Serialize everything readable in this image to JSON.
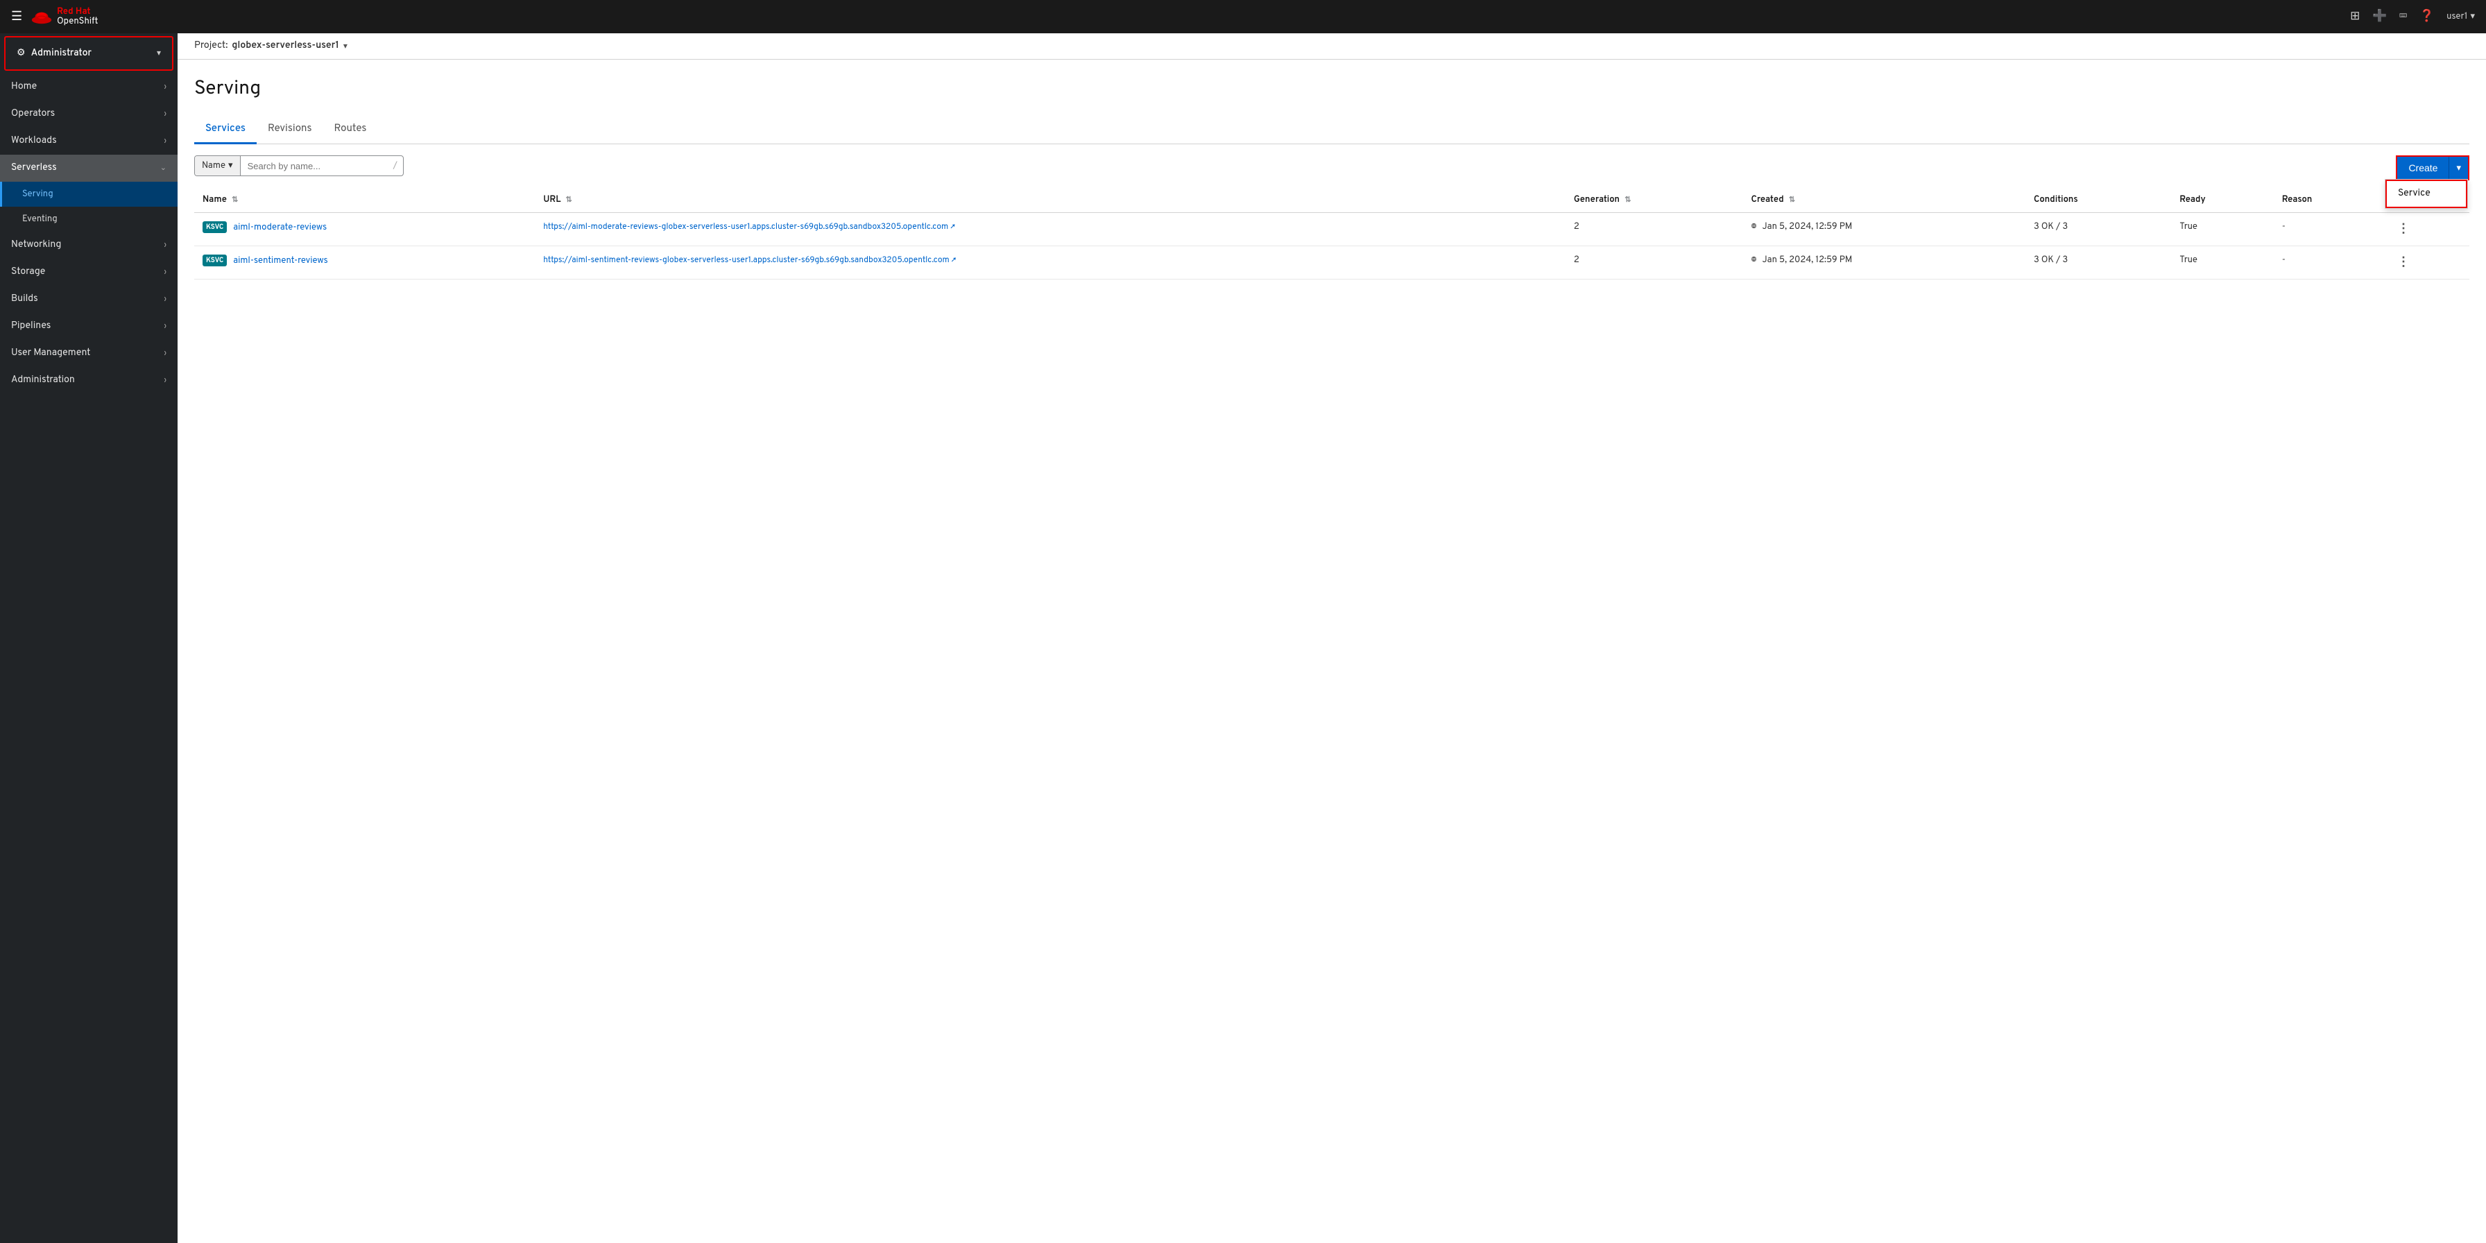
{
  "topnav": {
    "brand_red": "Red Hat",
    "brand_sub": "OpenShift",
    "user_label": "user1"
  },
  "sidebar": {
    "role_label": "Administrator",
    "nav_items": [
      {
        "id": "home",
        "label": "Home",
        "has_children": true
      },
      {
        "id": "operators",
        "label": "Operators",
        "has_children": true
      },
      {
        "id": "workloads",
        "label": "Workloads",
        "has_children": true
      },
      {
        "id": "serverless",
        "label": "Serverless",
        "has_children": true,
        "expanded": true
      },
      {
        "id": "networking",
        "label": "Networking",
        "has_children": true
      },
      {
        "id": "storage",
        "label": "Storage",
        "has_children": true
      },
      {
        "id": "builds",
        "label": "Builds",
        "has_children": true
      },
      {
        "id": "pipelines",
        "label": "Pipelines",
        "has_children": true
      },
      {
        "id": "user_management",
        "label": "User Management",
        "has_children": true
      },
      {
        "id": "administration",
        "label": "Administration",
        "has_children": true
      }
    ],
    "serverless_sub_items": [
      {
        "id": "serving",
        "label": "Serving",
        "active": true
      },
      {
        "id": "eventing",
        "label": "Eventing",
        "active": false
      }
    ]
  },
  "project_bar": {
    "label": "Project:",
    "project_name": "globex-serverless-user1"
  },
  "page": {
    "title": "Serving",
    "tabs": [
      {
        "id": "services",
        "label": "Services",
        "active": true
      },
      {
        "id": "revisions",
        "label": "Revisions",
        "active": false
      },
      {
        "id": "routes",
        "label": "Routes",
        "active": false
      }
    ]
  },
  "toolbar": {
    "filter_label": "Name",
    "search_placeholder": "Search by name...",
    "create_button": "Create",
    "create_dropdown_items": [
      "Service"
    ]
  },
  "table": {
    "columns": [
      "Name",
      "URL",
      "Generation",
      "Created",
      "Conditions",
      "Ready",
      "Reason"
    ],
    "rows": [
      {
        "badge": "KSVC",
        "name": "aiml-moderate-reviews",
        "url": "https://aiml-moderate-reviews-globex-serverless-user1.apps.cluster-s69gb.s69gb.sandbox3205.opentlc.com",
        "generation": "2",
        "created": "Jan 5, 2024, 12:59 PM",
        "conditions": "3 OK / 3",
        "ready": "True",
        "reason": "-"
      },
      {
        "badge": "KSVC",
        "name": "aiml-sentiment-reviews",
        "url": "https://aiml-sentiment-reviews-globex-serverless-user1.apps.cluster-s69gb.s69gb.sandbox3205.opentlc.com",
        "generation": "2",
        "created": "Jan 5, 2024, 12:59 PM",
        "conditions": "3 OK / 3",
        "ready": "True",
        "reason": "-"
      }
    ]
  },
  "dropdown_open": true,
  "service_menu_label": "Service"
}
